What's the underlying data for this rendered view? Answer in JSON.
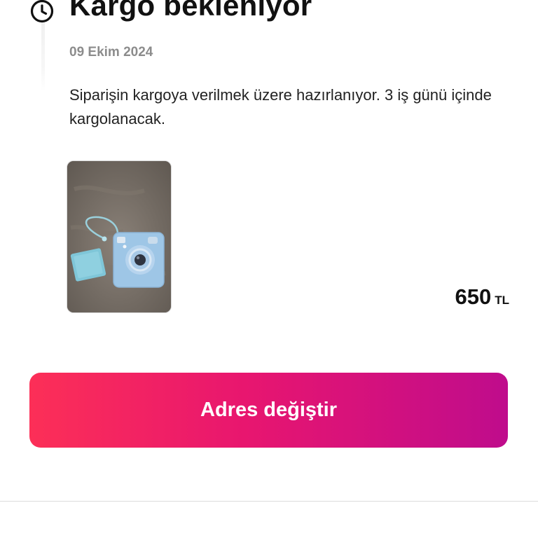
{
  "status": {
    "title": "Kargo bekleniyor",
    "date": "09 Ekim 2024",
    "description": "Siparişin kargoya verilmek üzere hazırlanıyor. 3 iş günü içinde kargolanacak.",
    "icon": "clock-icon"
  },
  "product": {
    "image_icon": "instant-camera-photo",
    "price": "650",
    "currency": "TL"
  },
  "actions": {
    "change_address_label": "Adres değiştir"
  },
  "colors": {
    "button_gradient_start": "#fc2f57",
    "button_gradient_end": "#bf0c8c",
    "date_text": "#8c8c8c"
  }
}
